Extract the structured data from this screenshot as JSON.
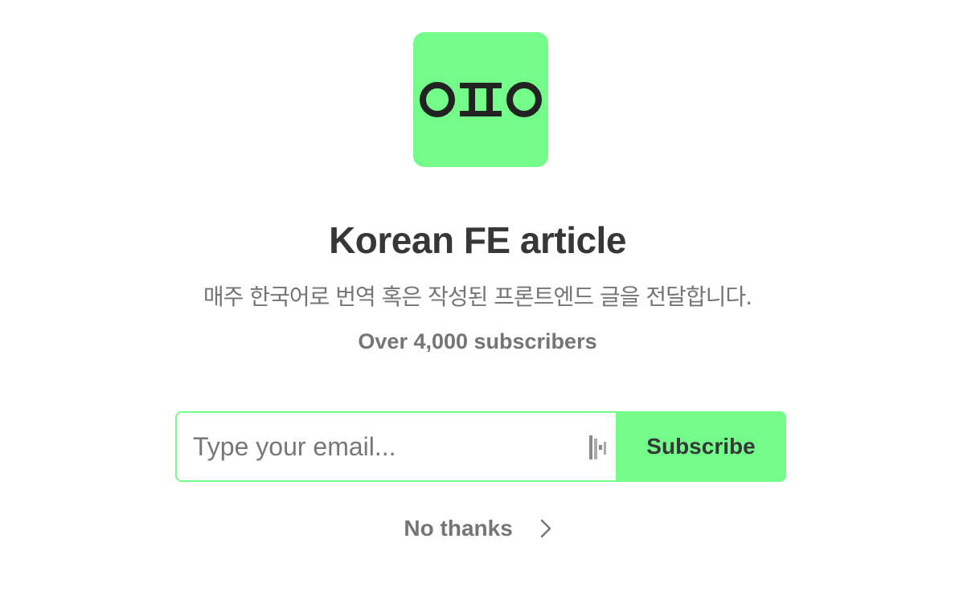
{
  "logo": {
    "icon": "korean-glyph-logo",
    "background": "#74fc8a",
    "glyph_color": "#222222"
  },
  "title": "Korean FE article",
  "description": "매주 한국어로 번역 혹은 작성된 프론트엔드 글을 전달합니다.",
  "subscribers": "Over 4,000 subscribers",
  "form": {
    "email_placeholder": "Type your email...",
    "email_value": "",
    "password_manager_icon": "password-manager-icon",
    "subscribe_label": "Subscribe"
  },
  "no_thanks": {
    "label": "No thanks",
    "icon": "chevron-right-icon"
  },
  "colors": {
    "accent": "#74fc8a",
    "text_dark": "#363737",
    "text_muted": "#757575"
  }
}
